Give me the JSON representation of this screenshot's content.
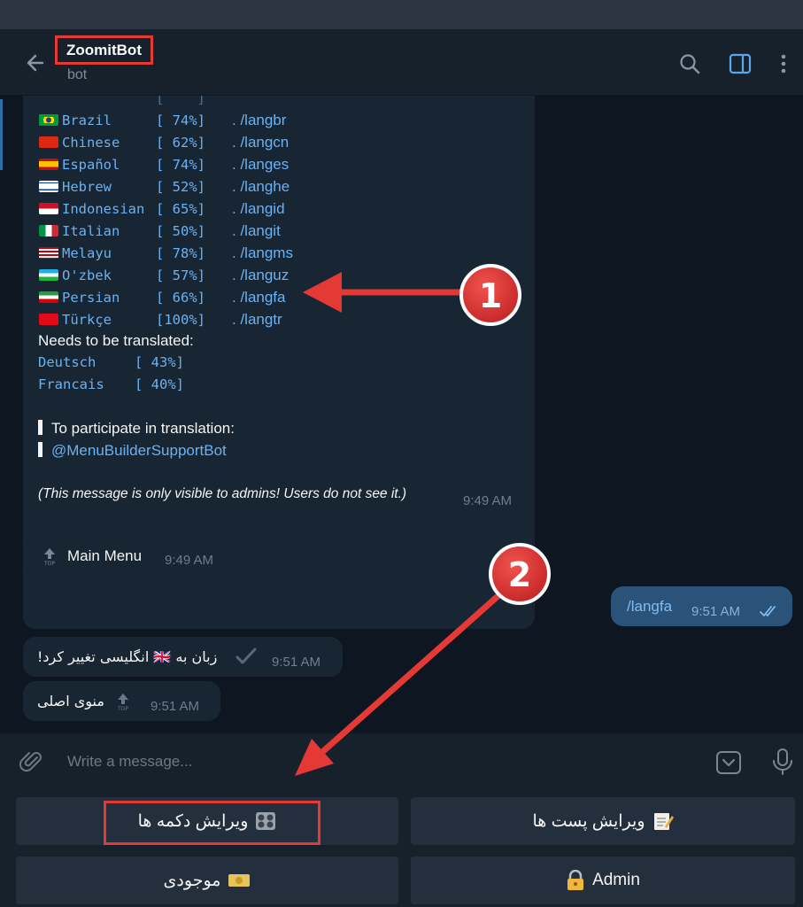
{
  "header": {
    "title": "ZoomitBot",
    "subtitle": "bot"
  },
  "languages": [
    {
      "name": "Brazil",
      "percent": "[ 74%]",
      "cmd": ". /langbr",
      "flag": "brazil-flag-icon"
    },
    {
      "name": "Chinese",
      "percent": "[ 62%]",
      "cmd": ". /langcn",
      "flag": "china-flag-icon"
    },
    {
      "name": "Español",
      "percent": "[ 74%]",
      "cmd": ". /langes",
      "flag": "spain-flag-icon"
    },
    {
      "name": "Hebrew",
      "percent": "[ 52%]",
      "cmd": ". /langhe",
      "flag": "israel-flag-icon"
    },
    {
      "name": "Indonesian",
      "percent": "[ 65%]",
      "cmd": ". /langid",
      "flag": "indonesia-flag-icon"
    },
    {
      "name": "Italian",
      "percent": "[ 50%]",
      "cmd": ". /langit",
      "flag": "italy-flag-icon"
    },
    {
      "name": "Melayu",
      "percent": "[ 78%]",
      "cmd": ". /langms",
      "flag": "malaysia-flag-icon"
    },
    {
      "name": "O'zbek",
      "percent": "[ 57%]",
      "cmd": ". /languz",
      "flag": "uzbekistan-flag-icon"
    },
    {
      "name": "Persian",
      "percent": "[ 66%]",
      "cmd": ". /langfa",
      "flag": "iran-flag-icon"
    },
    {
      "name": "Türkçe",
      "percent": "[100%]",
      "cmd": ". /langtr",
      "flag": "turkey-flag-icon"
    }
  ],
  "translate": {
    "heading": "Needs to be translated:",
    "items": [
      {
        "name": "Deutsch",
        "percent": "[ 43%]"
      },
      {
        "name": "Francais",
        "percent": "[ 40%]"
      }
    ],
    "participate": "To participate in translation:",
    "support_link": "@MenuBuilderSupportBot",
    "admin_note": "(This message is only visible to admins! Users do not see it.)",
    "time": "9:49 AM"
  },
  "messages": {
    "main_menu": {
      "text": "Main Menu",
      "time": "9:49 AM"
    },
    "outgoing": {
      "text": "/langfa",
      "time": "9:51 AM"
    },
    "lang_changed": {
      "text": "زبان به 🇬🇧 انگلیسی تغییر کرد!",
      "time": "9:51 AM"
    },
    "main_menu_fa": {
      "text": "منوی اصلی",
      "time": "9:51 AM"
    }
  },
  "input": {
    "placeholder": "Write a message..."
  },
  "keyboard": {
    "edit_buttons": "ویرایش دکمه ها",
    "edit_posts": "ویرایش پست ها",
    "balance": "موجودی",
    "admin": "Admin"
  },
  "annotations": {
    "badge1": "1",
    "badge2": "2"
  },
  "colors": {
    "background": "#0e1621",
    "header": "#17212b",
    "incoming_bubble": "#182533",
    "outgoing_bubble": "#2b5278",
    "link": "#6ab2f2",
    "annotation_red": "#e53935"
  }
}
